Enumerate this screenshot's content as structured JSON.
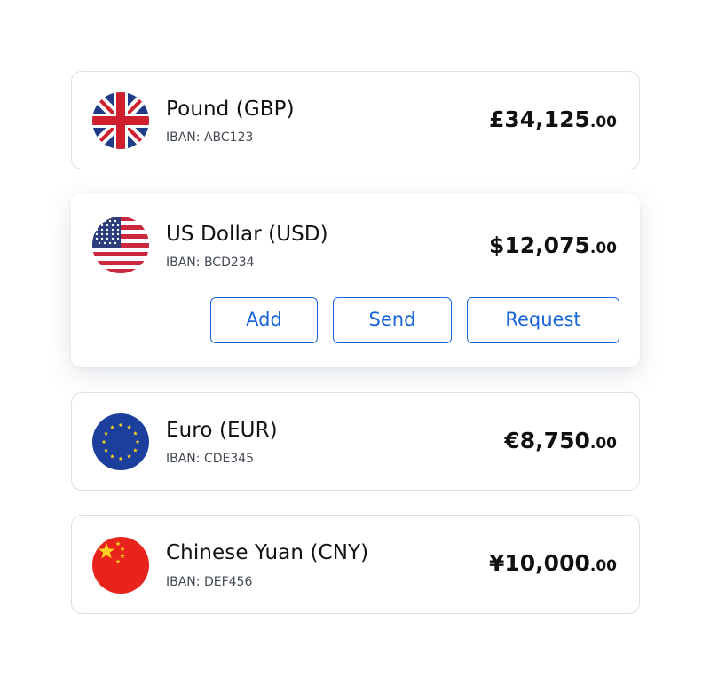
{
  "accounts": [
    {
      "name": "Pound (GBP)",
      "iban": "IBAN: ABC123",
      "amount_major": "£34,125",
      "amount_minor": ".00",
      "flag_icon": "uk-flag-icon"
    },
    {
      "name": "US Dollar (USD)",
      "iban": "IBAN: BCD234",
      "amount_major": "$12,075",
      "amount_minor": ".00",
      "flag_icon": "us-flag-icon",
      "actions": {
        "add": "Add",
        "send": "Send",
        "request": "Request"
      }
    },
    {
      "name": "Euro (EUR)",
      "iban": "IBAN: CDE345",
      "amount_major": "€8,750",
      "amount_minor": ".00",
      "flag_icon": "eu-flag-icon"
    },
    {
      "name": "Chinese Yuan (CNY)",
      "iban": "IBAN: DEF456",
      "amount_major": "¥10,000",
      "amount_minor": ".00",
      "flag_icon": "china-flag-icon"
    }
  ],
  "colors": {
    "accent": "#1a66d6",
    "card_border": "#dcdfe3",
    "text_primary": "#111111",
    "text_secondary": "#444b55"
  }
}
